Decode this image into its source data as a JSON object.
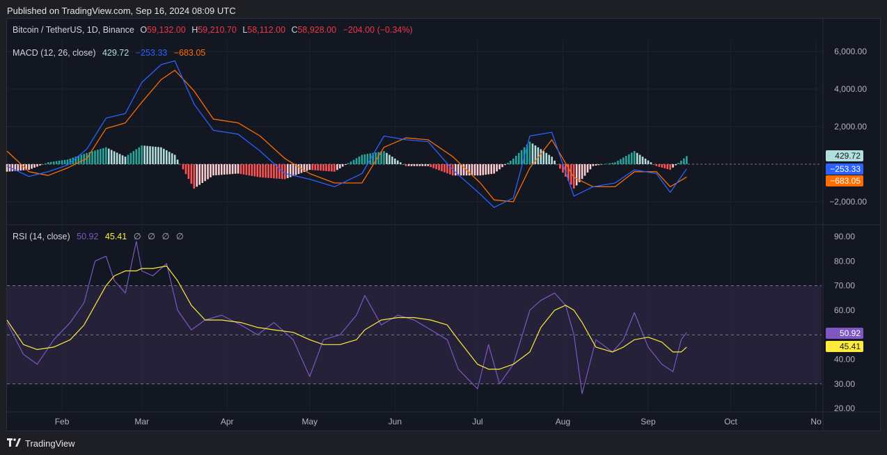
{
  "published": "Published on TradingView.com, Sep 16, 2024 08:09 UTC",
  "symbol": {
    "name": "Bitcoin / TetherUS, 1D, Binance",
    "o_label": "O",
    "o": "59,132.00",
    "h_label": "H",
    "h": "59,210.70",
    "l_label": "L",
    "l": "58,112.00",
    "c_label": "C",
    "c": "58,928.00",
    "change": "−204.00 (−0.34%)"
  },
  "macd": {
    "title": "MACD (12, 26, close)",
    "hist_value": "429.72",
    "macd_value": "−253.33",
    "signal_value": "−683.05"
  },
  "rsi": {
    "title": "RSI (14, close)",
    "rsi_value": "50.92",
    "ma_value": "45.41",
    "na_values": [
      "∅",
      "∅",
      "∅",
      "∅"
    ]
  },
  "brand": "TradingView",
  "colors": {
    "macd_line": "#2962ff",
    "signal_line": "#ff6d00",
    "hist_pos_strong": "#26a69a",
    "hist_pos_weak": "#b2dfdb",
    "hist_neg_strong": "#ff5252",
    "hist_neg_weak": "#ffcdd2",
    "rsi_line": "#7e57c2",
    "rsi_ma": "#ffeb3b",
    "rsi_band": "#2a2440"
  },
  "chart_data": [
    {
      "type": "line",
      "panel": "MACD",
      "title": "MACD (12, 26, close)",
      "x_ticks": [
        "Feb",
        "Mar",
        "Apr",
        "May",
        "Jun",
        "Jul",
        "Aug",
        "Sep",
        "Oct",
        "No"
      ],
      "y_ticks": [
        "6,000.00",
        "4,000.00",
        "2,000.00",
        "−2,000.00"
      ],
      "ylim": [
        -2900,
        6200
      ],
      "x_range": [
        "2024-01-12",
        "2024-11-03"
      ],
      "last_values": {
        "histogram": 429.72,
        "macd": -253.33,
        "signal": -683.05
      },
      "series": [
        {
          "name": "MACD",
          "x": [
            "2024-01-12",
            "2024-01-20",
            "2024-01-27",
            "2024-02-03",
            "2024-02-10",
            "2024-02-17",
            "2024-02-24",
            "2024-03-01",
            "2024-03-08",
            "2024-03-13",
            "2024-03-20",
            "2024-03-27",
            "2024-04-05",
            "2024-04-13",
            "2024-04-22",
            "2024-05-01",
            "2024-05-10",
            "2024-05-20",
            "2024-05-28",
            "2024-06-05",
            "2024-06-13",
            "2024-06-22",
            "2024-07-02",
            "2024-07-07",
            "2024-07-14",
            "2024-07-20",
            "2024-07-28",
            "2024-08-05",
            "2024-08-12",
            "2024-08-20",
            "2024-08-27",
            "2024-09-04",
            "2024-09-09",
            "2024-09-15"
          ],
          "values": [
            -100,
            -650,
            -400,
            -50,
            800,
            2450,
            2700,
            4350,
            5300,
            5500,
            3200,
            1800,
            1600,
            700,
            -500,
            -800,
            -1200,
            -500,
            1500,
            1300,
            1200,
            -300,
            -1600,
            -2300,
            -1800,
            1500,
            1700,
            -1700,
            -1200,
            -1000,
            -300,
            -500,
            -1500,
            -253
          ]
        },
        {
          "name": "Signal",
          "x": [
            "2024-01-12",
            "2024-01-20",
            "2024-01-27",
            "2024-02-03",
            "2024-02-10",
            "2024-02-17",
            "2024-02-24",
            "2024-03-01",
            "2024-03-08",
            "2024-03-13",
            "2024-03-20",
            "2024-03-27",
            "2024-04-05",
            "2024-04-13",
            "2024-04-22",
            "2024-05-01",
            "2024-05-10",
            "2024-05-20",
            "2024-05-28",
            "2024-06-05",
            "2024-06-13",
            "2024-06-22",
            "2024-07-02",
            "2024-07-07",
            "2024-07-14",
            "2024-07-20",
            "2024-07-28",
            "2024-08-05",
            "2024-08-12",
            "2024-08-20",
            "2024-08-27",
            "2024-09-04",
            "2024-09-09",
            "2024-09-15"
          ],
          "values": [
            700,
            -400,
            -600,
            -200,
            300,
            1900,
            2200,
            3300,
            4500,
            5000,
            3900,
            2400,
            2200,
            1500,
            300,
            -500,
            -1000,
            -1000,
            900,
            1400,
            1300,
            400,
            -1000,
            -1900,
            -2000,
            -200,
            1300,
            -700,
            -1200,
            -1200,
            -400,
            -400,
            -1200,
            -683
          ]
        },
        {
          "name": "Histogram",
          "x": [
            "2024-01-12",
            "2024-01-20",
            "2024-01-27",
            "2024-02-03",
            "2024-02-10",
            "2024-02-17",
            "2024-02-24",
            "2024-03-01",
            "2024-03-08",
            "2024-03-13",
            "2024-03-20",
            "2024-03-27",
            "2024-04-05",
            "2024-04-13",
            "2024-04-22",
            "2024-05-01",
            "2024-05-10",
            "2024-05-20",
            "2024-05-28",
            "2024-06-05",
            "2024-06-13",
            "2024-06-22",
            "2024-07-02",
            "2024-07-07",
            "2024-07-14",
            "2024-07-20",
            "2024-07-28",
            "2024-08-05",
            "2024-08-12",
            "2024-08-20",
            "2024-08-27",
            "2024-09-04",
            "2024-09-09",
            "2024-09-15"
          ],
          "values": [
            -400,
            -300,
            100,
            250,
            600,
            900,
            400,
            1000,
            900,
            500,
            -1300,
            -600,
            -500,
            -700,
            -800,
            -300,
            -400,
            500,
            700,
            -100,
            -100,
            -600,
            -600,
            -500,
            300,
            1200,
            400,
            -1300,
            -100,
            100,
            700,
            -100,
            -300,
            430
          ]
        }
      ]
    },
    {
      "type": "line",
      "panel": "RSI",
      "title": "RSI (14, close)",
      "x_ticks": [
        "Feb",
        "Mar",
        "Apr",
        "May",
        "Jun",
        "Jul",
        "Aug",
        "Sep",
        "Oct",
        "No"
      ],
      "y_ticks": [
        "90.00",
        "80.00",
        "70.00",
        "60.00",
        "50.00",
        "40.00",
        "30.00",
        "20.00"
      ],
      "ylim": [
        20,
        90
      ],
      "bands": {
        "upper": 70,
        "middle": 50,
        "lower": 30
      },
      "x_range": [
        "2024-01-12",
        "2024-11-03"
      ],
      "last_values": {
        "rsi": 50.92,
        "rsi_ma": 45.41
      },
      "series": [
        {
          "name": "RSI",
          "x": [
            "2024-01-12",
            "2024-01-18",
            "2024-01-23",
            "2024-01-29",
            "2024-02-04",
            "2024-02-09",
            "2024-02-13",
            "2024-02-17",
            "2024-02-20",
            "2024-02-24",
            "2024-02-28",
            "2024-03-01",
            "2024-03-05",
            "2024-03-10",
            "2024-03-14",
            "2024-03-19",
            "2024-03-24",
            "2024-03-30",
            "2024-04-06",
            "2024-04-12",
            "2024-04-18",
            "2024-04-25",
            "2024-05-01",
            "2024-05-06",
            "2024-05-12",
            "2024-05-18",
            "2024-05-21",
            "2024-05-27",
            "2024-06-02",
            "2024-06-08",
            "2024-06-14",
            "2024-06-20",
            "2024-06-24",
            "2024-07-01",
            "2024-07-05",
            "2024-07-09",
            "2024-07-14",
            "2024-07-20",
            "2024-07-24",
            "2024-07-29",
            "2024-08-02",
            "2024-08-05",
            "2024-08-08",
            "2024-08-13",
            "2024-08-19",
            "2024-08-23",
            "2024-08-27",
            "2024-09-01",
            "2024-09-06",
            "2024-09-10",
            "2024-09-13",
            "2024-09-15"
          ],
          "values": [
            55,
            42,
            38,
            48,
            55,
            63,
            80,
            82,
            72,
            67,
            88,
            76,
            74,
            79,
            60,
            52,
            56,
            58,
            54,
            50,
            55,
            48,
            33,
            48,
            50,
            58,
            66,
            54,
            58,
            56,
            52,
            48,
            36,
            28,
            46,
            30,
            38,
            60,
            64,
            67,
            62,
            50,
            26,
            48,
            43,
            48,
            59,
            45,
            38,
            35,
            48,
            51
          ]
        },
        {
          "name": "RSI MA",
          "x": [
            "2024-01-12",
            "2024-01-18",
            "2024-01-23",
            "2024-01-29",
            "2024-02-04",
            "2024-02-09",
            "2024-02-13",
            "2024-02-17",
            "2024-02-20",
            "2024-02-24",
            "2024-02-28",
            "2024-03-01",
            "2024-03-05",
            "2024-03-10",
            "2024-03-14",
            "2024-03-19",
            "2024-03-24",
            "2024-03-30",
            "2024-04-06",
            "2024-04-12",
            "2024-04-18",
            "2024-04-25",
            "2024-05-01",
            "2024-05-06",
            "2024-05-12",
            "2024-05-18",
            "2024-05-21",
            "2024-05-27",
            "2024-06-02",
            "2024-06-08",
            "2024-06-14",
            "2024-06-20",
            "2024-06-24",
            "2024-07-01",
            "2024-07-05",
            "2024-07-09",
            "2024-07-14",
            "2024-07-20",
            "2024-07-24",
            "2024-07-29",
            "2024-08-02",
            "2024-08-05",
            "2024-08-08",
            "2024-08-13",
            "2024-08-19",
            "2024-08-23",
            "2024-08-27",
            "2024-09-01",
            "2024-09-06",
            "2024-09-10",
            "2024-09-13",
            "2024-09-15"
          ],
          "values": [
            56,
            46,
            44,
            45,
            48,
            54,
            62,
            70,
            74,
            76,
            76,
            77,
            77,
            78,
            72,
            62,
            56,
            56,
            55,
            53,
            52,
            51,
            48,
            46,
            46,
            48,
            52,
            56,
            57,
            57,
            56,
            54,
            48,
            38,
            36,
            36,
            38,
            43,
            53,
            60,
            62,
            60,
            55,
            45,
            43,
            45,
            48,
            49,
            47,
            43,
            43,
            45
          ]
        }
      ]
    }
  ]
}
